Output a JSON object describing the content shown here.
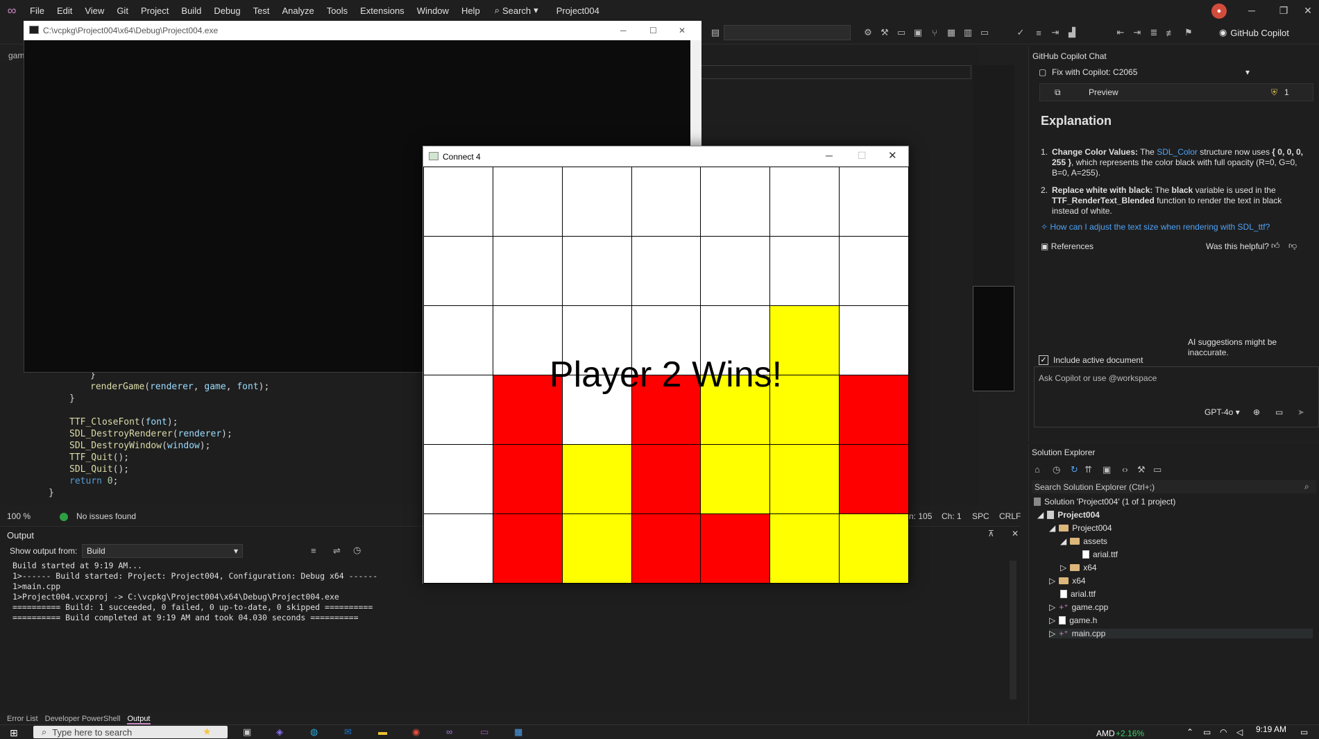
{
  "menubar": {
    "items": [
      "File",
      "Edit",
      "View",
      "Git",
      "Project",
      "Build",
      "Debug",
      "Test",
      "Analyze",
      "Tools",
      "Extensions",
      "Window",
      "Help"
    ],
    "search_label": "Search",
    "project_name": "Project004"
  },
  "toolbar": {
    "copilot_label": "GitHub Copilot"
  },
  "editor": {
    "tab_fragment": "gam",
    "code_lines": [
      "}",
      "    renderGame(renderer, game, font);",
      "}",
      "",
      "TTF_CloseFont(font);",
      "SDL_DestroyRenderer(renderer);",
      "SDL_DestroyWindow(window);",
      "TTF_Quit();",
      "SDL_Quit();",
      "return 0;"
    ],
    "closing_brace": "}"
  },
  "editor_status": {
    "zoom": "100 %",
    "issues": "No issues found",
    "line": "n: 105",
    "col": "Ch: 1",
    "whitespace": "SPC",
    "eol": "CRLF"
  },
  "output": {
    "title": "Output",
    "from_label": "Show output from:",
    "source": "Build",
    "lines": [
      "Build started at 9:19 AM...",
      "1>------ Build started: Project: Project004, Configuration: Debug x64 ------",
      "1>main.cpp",
      "1>Project004.vcxproj -> C:\\vcpkg\\Project004\\x64\\Debug\\Project004.exe",
      "========== Build: 1 succeeded, 0 failed, 0 up-to-date, 0 skipped ==========",
      "========== Build completed at 9:19 AM and took 04.030 seconds =========="
    ]
  },
  "bottom_tabs": [
    "Error List",
    "Developer PowerShell",
    "Output"
  ],
  "console": {
    "title": "C:\\vcpkg\\Project004\\x64\\Debug\\Project004.exe"
  },
  "copilot": {
    "panel_title": "GitHub Copilot Chat",
    "thread": "Fix with Copilot: C2065",
    "preview_label": "Preview",
    "badge_count": "1",
    "heading": "Explanation",
    "item1_bold": "Change Color Values:",
    "item1_text_a": "The",
    "item1_link": "SDL_Color",
    "item1_text_b": "structure now uses",
    "item1_code": "{ 0, 0, 0, 255 }",
    "item1_text_c": ", which represents the color black with full opacity (R=0, G=0, B=0, A=255).",
    "item2_bold": "Replace white with black:",
    "item2_text_a": "The",
    "item2_var": "black",
    "item2_text_b": "variable is used in the",
    "item2_fn": "TTF_RenderText_Blended",
    "item2_text_c": "function to render the text in black instead of white.",
    "suggestion": "How can I adjust the text size when rendering with SDL_ttf?",
    "references_label": "References",
    "helpful_label": "Was this helpful?",
    "disclaimer": "AI suggestions might be inaccurate.",
    "include_doc_label": "Include active document",
    "input_placeholder": "Ask Copilot or use @workspace",
    "model": "GPT-4o"
  },
  "solution_explorer": {
    "title": "Solution Explorer",
    "search_placeholder": "Search Solution Explorer (Ctrl+;)",
    "solution_label": "Solution 'Project004' (1 of 1 project)",
    "project_label": "Project004",
    "folder_project": "Project004",
    "folder_assets": "assets",
    "file_arial_inner": "arial.ttf",
    "folder_x64_inner": "x64",
    "folder_x64": "x64",
    "file_arial": "arial.ttf",
    "file_game_cpp": "game.cpp",
    "file_game_h": "game.h",
    "file_main_cpp": "main.cpp"
  },
  "connect4": {
    "title": "Connect 4",
    "message": "Player 2 Wins!",
    "colors": {
      "empty": "#ffffff",
      "red": "#ff0000",
      "yellow": "#ffff00"
    },
    "board": [
      [
        "empty",
        "empty",
        "empty",
        "empty",
        "empty",
        "empty",
        "empty"
      ],
      [
        "empty",
        "empty",
        "empty",
        "empty",
        "empty",
        "empty",
        "empty"
      ],
      [
        "empty",
        "empty",
        "empty",
        "empty",
        "empty",
        "yellow",
        "empty"
      ],
      [
        "empty",
        "red",
        "empty",
        "red",
        "yellow",
        "yellow",
        "red"
      ],
      [
        "empty",
        "red",
        "yellow",
        "red",
        "yellow",
        "yellow",
        "red"
      ],
      [
        "empty",
        "red",
        "yellow",
        "red",
        "red",
        "yellow",
        "yellow"
      ]
    ]
  },
  "taskbar": {
    "search_placeholder": "Type here to search",
    "cpu_label": "AMD",
    "cpu_value": "+2.16%",
    "time": "9:19 AM"
  }
}
